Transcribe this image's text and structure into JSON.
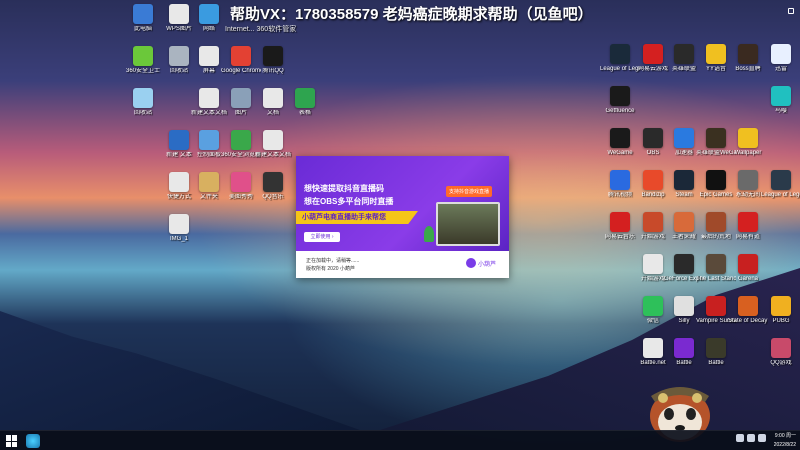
{
  "banner": {
    "text": "帮助VX：1780358579 老妈癌症晚期求帮助（见鱼吧）"
  },
  "subcaption": {
    "text": "Internet... 360软件管家"
  },
  "desktop": {
    "left_icons": [
      {
        "label": "此电脑",
        "icon": "computer-icon",
        "color": "#3a7bd5"
      },
      {
        "label": "WPS图片",
        "icon": "image-file-icon",
        "color": "#e8e8e8"
      },
      {
        "label": "网络",
        "icon": "network-icon",
        "color": "#3a9be0"
      },
      {
        "label": "360安全卫士",
        "icon": "shield-icon",
        "color": "#6bc83a"
      },
      {
        "label": "回收站",
        "icon": "recycle-bin-icon",
        "color": "#aab4c0"
      },
      {
        "label": "屏幕",
        "icon": "file-icon",
        "color": "#e8e8e8"
      },
      {
        "label": "Google Chrome",
        "icon": "chrome-icon",
        "color": "#e34133"
      },
      {
        "label": "腾讯QQ",
        "icon": "qq-icon",
        "color": "#1a1a1a"
      },
      {
        "label": "回收站",
        "icon": "trash-icon",
        "color": "#9ad0f0"
      },
      {
        "label": "新建文本文档",
        "icon": "text-file-icon",
        "color": "#e8e8e8"
      },
      {
        "label": "图片",
        "icon": "image-icon",
        "color": "#8aa0b8"
      },
      {
        "label": "文档",
        "icon": "doc-icon",
        "color": "#e8e8e8"
      },
      {
        "label": "表格",
        "icon": "sheet-icon",
        "color": "#2ea44f"
      },
      {
        "label": "新建 文本",
        "icon": "word-icon",
        "color": "#2b6cc4"
      },
      {
        "label": "控制面板",
        "icon": "control-panel-icon",
        "color": "#5aa0e0"
      },
      {
        "label": "360安全浏览器",
        "icon": "browser-icon",
        "color": "#3aa84a"
      },
      {
        "label": "快捷方式",
        "icon": "shortcut-icon",
        "color": "#e8e8e8"
      },
      {
        "label": "新建文本文档",
        "icon": "file-icon-2",
        "color": "#e8e8e8"
      },
      {
        "label": "文件夹",
        "icon": "folder-icon",
        "color": "#d8b060"
      },
      {
        "label": "美图秀秀",
        "icon": "photo-app-icon",
        "color": "#e0508a"
      },
      {
        "label": "QQ音乐",
        "icon": "phone-icon",
        "color": "#333333"
      },
      {
        "label": "IMG_1",
        "icon": "image-file-icon-2",
        "color": "#e8e8e8"
      }
    ],
    "right_icons": [
      {
        "label": "League of Legends",
        "icon": "lol-icon",
        "color": "#1a2a3a"
      },
      {
        "label": "网易云游戏",
        "icon": "netease-game-icon",
        "color": "#d42020"
      },
      {
        "label": "英雄联盟",
        "icon": "lol2-icon",
        "color": "#2a2a2a"
      },
      {
        "label": "YY语音",
        "icon": "yy-icon",
        "color": "#f0c020"
      },
      {
        "label": "Boss直聘",
        "icon": "boss-icon",
        "color": "#3a2a20"
      },
      {
        "label": "迅雷",
        "icon": "thunder-icon",
        "color": "#e8f0ff"
      },
      {
        "label": "Getfluence",
        "icon": "g-icon",
        "color": "#1a1a1a"
      },
      {
        "label": "鸟嘤",
        "icon": "bird-icon",
        "color": "#20c0c0"
      },
      {
        "label": "WeGame",
        "icon": "wegame-icon",
        "color": "#1a1a1a"
      },
      {
        "label": "OBS",
        "icon": "obs-icon",
        "color": "#2a2a2a"
      },
      {
        "label": "加速器",
        "icon": "accelerator-icon",
        "color": "#2a7ae0"
      },
      {
        "label": "英雄联盟WeGame版",
        "icon": "lol3-icon",
        "color": "#3a3020"
      },
      {
        "label": "Wallpaper",
        "icon": "wallpaper-icon",
        "color": "#f0c020"
      },
      {
        "label": "腾讯视频",
        "icon": "tencent-video-icon",
        "color": "#2a6ae0"
      },
      {
        "label": "Bandizip",
        "icon": "bandizip-icon",
        "color": "#e84a2a"
      },
      {
        "label": "Steam",
        "icon": "steam-icon",
        "color": "#1b2838"
      },
      {
        "label": "Epic Games",
        "icon": "epic-icon",
        "color": "#111111"
      },
      {
        "label": "永劫无间",
        "icon": "naraka-icon",
        "color": "#6a6a6a"
      },
      {
        "label": "League of Legends",
        "icon": "lol4-icon",
        "color": "#2a3a4a"
      },
      {
        "label": "网易云音乐",
        "icon": "netease-music-icon",
        "color": "#d42020"
      },
      {
        "label": "开始游戏",
        "icon": "game-start-icon",
        "color": "#c84a2a"
      },
      {
        "label": "王者荣耀",
        "icon": "wzry-icon",
        "color": "#d86a3a"
      },
      {
        "label": "最后的荒地",
        "icon": "game-icon-2",
        "color": "#a04a2a"
      },
      {
        "label": "网易有道",
        "icon": "youdao-icon",
        "color": "#d42020"
      },
      {
        "label": "开始游戏",
        "icon": "ghost-icon",
        "color": "#e8e8e8"
      },
      {
        "label": "GeForce Experience",
        "icon": "geforce-icon",
        "color": "#2a2a2a"
      },
      {
        "label": "The Last Stand",
        "icon": "last-stand-icon",
        "color": "#5a4a3a"
      },
      {
        "label": "Garena",
        "icon": "garena-icon",
        "color": "#c82020"
      },
      {
        "label": "微信",
        "icon": "wechat-icon",
        "color": "#2ec05a"
      },
      {
        "label": "Silly",
        "icon": "silly-icon",
        "color": "#e0e0e0"
      },
      {
        "label": "Vampire Survivors",
        "icon": "vampire-icon",
        "color": "#c82020"
      },
      {
        "label": "State of Decay 2",
        "icon": "decay-icon",
        "color": "#d86020"
      },
      {
        "label": "PUBG",
        "icon": "pubg-icon",
        "color": "#f0b020"
      },
      {
        "label": "Battle.net",
        "icon": "battlenet-icon",
        "color": "#e8e8e8"
      },
      {
        "label": "Battle",
        "icon": "battle2-icon",
        "color": "#7a2ad0"
      },
      {
        "label": "Battle",
        "icon": "battle3-icon",
        "color": "#3a3a2a"
      },
      {
        "label": "QQ游戏",
        "icon": "qqgame-icon",
        "color": "#c84a6a"
      }
    ]
  },
  "popup": {
    "line1": "想快速提取抖音直播码",
    "line2": "想在OBS多平台同时直播",
    "bar": "小葫芦电商直播助手来帮您",
    "tag": "支持抖音游戏直播",
    "button": "立即使用 ›",
    "foot1": "正在加载中，请稍等......",
    "foot2": "版权所有 2020 小葫芦",
    "brand": "小葫芦"
  },
  "taskbar": {
    "time": "9:00 周一",
    "date": "2022/8/22"
  }
}
